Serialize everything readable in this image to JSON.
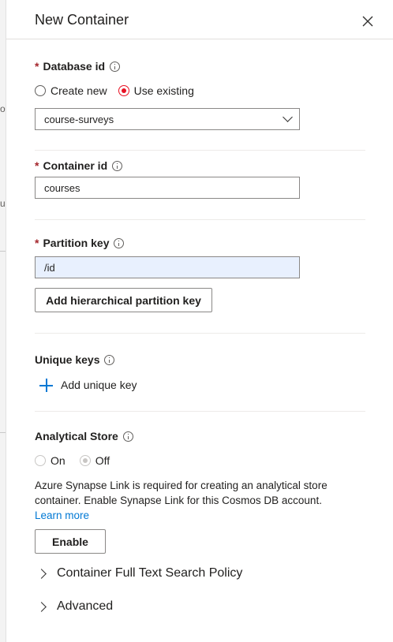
{
  "background": {
    "frag1": "o",
    "frag2": "u"
  },
  "header": {
    "title": "New Container"
  },
  "database": {
    "label": "Database id",
    "options": [
      "Create new",
      "Use existing"
    ],
    "selected": "Use existing",
    "value": "course-surveys"
  },
  "container": {
    "label": "Container id",
    "value": "courses"
  },
  "partition": {
    "label": "Partition key",
    "value": "/id",
    "add_button": "Add hierarchical partition key"
  },
  "unique_keys": {
    "label": "Unique keys",
    "add_label": "Add unique key"
  },
  "analytical": {
    "label": "Analytical Store",
    "options": [
      "On",
      "Off"
    ],
    "selected": "Off",
    "message_line1": "Azure Synapse Link is required for creating an analytical store",
    "message_line2": "container. Enable Synapse Link for this Cosmos DB account.",
    "learn_more": "Learn more",
    "enable_button": "Enable"
  },
  "sections": {
    "full_text": "Container Full Text Search Policy",
    "advanced": "Advanced"
  },
  "colors": {
    "required": "#a4262c",
    "radio_selected": "#e81123",
    "link": "#0078d4",
    "autofill_bg": "#e8f0fe"
  },
  "icons": {
    "close": "close-icon",
    "info": "info-icon",
    "plus": "plus-icon",
    "chevron_down": "chevron-down-icon",
    "chevron_right": "chevron-right-icon"
  }
}
